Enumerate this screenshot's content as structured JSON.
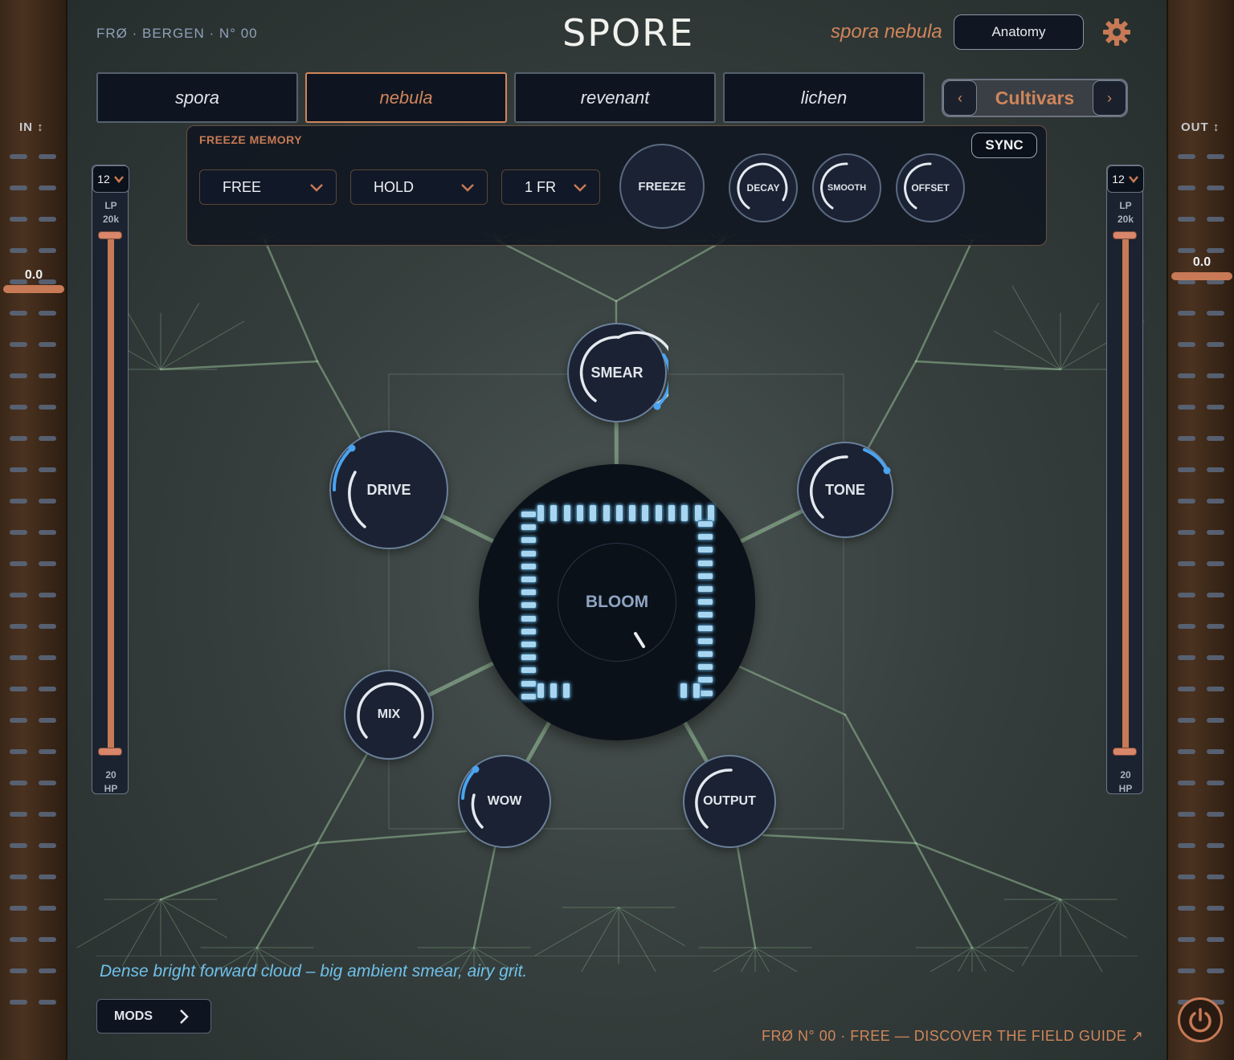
{
  "header": {
    "brand": "FRØ · BERGEN · N° 00",
    "title": "SPORE",
    "preset_name": "spora nebula",
    "anatomy_button": "Anatomy",
    "settings_icon": "gear-icon"
  },
  "tabs": [
    {
      "label": "spora",
      "active": false
    },
    {
      "label": "nebula",
      "active": true
    },
    {
      "label": "revenant",
      "active": false
    },
    {
      "label": "lichen",
      "active": false
    }
  ],
  "cultivars": {
    "label": "Cultivars",
    "prev": "‹",
    "next": "›"
  },
  "freeze_memory": {
    "heading": "FREEZE MEMORY",
    "sync_label": "SYNC",
    "dropdowns": [
      {
        "value": "FREE"
      },
      {
        "value": "HOLD"
      },
      {
        "value": "1 FR"
      }
    ],
    "freeze_button": "FREEZE",
    "knobs": [
      {
        "label": "DECAY"
      },
      {
        "label": "SMOOTH"
      },
      {
        "label": "OFFSET"
      }
    ]
  },
  "meters": {
    "input": {
      "label": "IN ↕",
      "value": "0.0"
    },
    "output": {
      "label": "OUT ↕",
      "value": "0.0"
    }
  },
  "filters": {
    "left": {
      "slope": "12",
      "top_label_1": "LP",
      "top_label_2": "20k",
      "bottom_label_1": "20",
      "bottom_label_2": "HP"
    },
    "right": {
      "slope": "12",
      "top_label_1": "LP",
      "top_label_2": "20k",
      "bottom_label_1": "20",
      "bottom_label_2": "HP"
    }
  },
  "knobs": {
    "smear": "SMEAR",
    "drive": "DRIVE",
    "tone": "TONE",
    "mix": "MIX",
    "wow": "WOW",
    "output": "OUTPUT",
    "bloom": "BLOOM"
  },
  "footer": {
    "description": "Dense bright forward cloud – big ambient smear, airy grit.",
    "mods_button": "MODS",
    "link": "FRØ N° 00 · FREE — DISCOVER THE FIELD GUIDE ↗"
  },
  "colors": {
    "accent": "#d0855a",
    "ring": "#4aa3f0",
    "led": "#a8d6f0",
    "vein": "#9fc8a0"
  }
}
